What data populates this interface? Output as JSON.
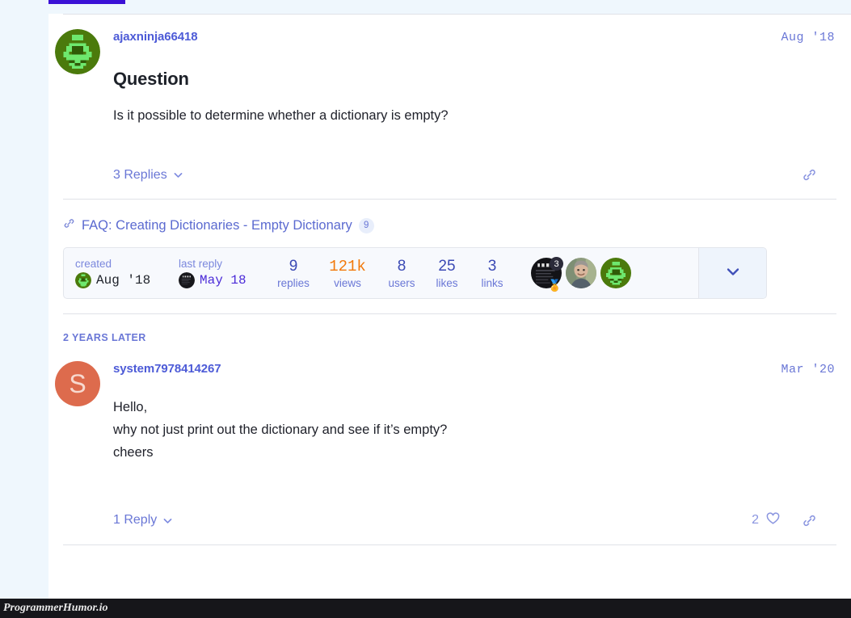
{
  "site": {
    "watermark": "ProgrammerHumor.io",
    "accent_purple": "#3b11d6",
    "link_color": "#6a77d6",
    "views_color": "#f2790b",
    "page_bg": "#eff7fd"
  },
  "posts": [
    {
      "author": "ajaxninja66418",
      "date": "Aug '18",
      "avatar_icon": "pixel-identicon-green",
      "title": "Question",
      "body": "Is it possible to determine whether a dictionary is empty?",
      "replies_label": "3 Replies",
      "chevron_icon": "chevron-down-icon",
      "share_icon": "link-icon"
    },
    {
      "author": "system7978414267",
      "date": "Mar '20",
      "avatar_letter": "S",
      "avatar_bg": "#dd6b4d",
      "body_lines": [
        "Hello,",
        "why not just print out the dictionary and see if it’s empty?",
        "cheers"
      ],
      "replies_label": "1 Reply",
      "chevron_icon": "chevron-down-icon",
      "like_count": "2",
      "like_icon": "heart-icon",
      "share_icon": "link-icon"
    }
  ],
  "linked_topic": {
    "icon": "link-icon",
    "title": "FAQ: Creating Dictionaries - Empty Dictionary",
    "count": "9"
  },
  "topic_stats": {
    "created": {
      "label": "created",
      "value": "Aug '18",
      "avatar_icon": "pixel-identicon-green"
    },
    "last_reply": {
      "label": "last reply",
      "value": "May 18",
      "avatar_icon": "dark-circle-avatar"
    },
    "counters": [
      {
        "value": "9",
        "label": "replies",
        "highlight": false
      },
      {
        "value": "121k",
        "label": "views",
        "highlight": true
      },
      {
        "value": "8",
        "label": "users",
        "highlight": false
      },
      {
        "value": "25",
        "label": "likes",
        "highlight": false
      },
      {
        "value": "3",
        "label": "links",
        "highlight": false
      }
    ],
    "participants": [
      {
        "name": "dark-avatar",
        "badge": "3",
        "medal": "🏅"
      },
      {
        "name": "photo-avatar",
        "badge": "",
        "medal": ""
      },
      {
        "name": "pixel-identicon-green",
        "badge": "",
        "medal": ""
      }
    ],
    "expand_icon": "chevron-down-icon"
  },
  "time_gap": {
    "label": "2 YEARS LATER"
  }
}
